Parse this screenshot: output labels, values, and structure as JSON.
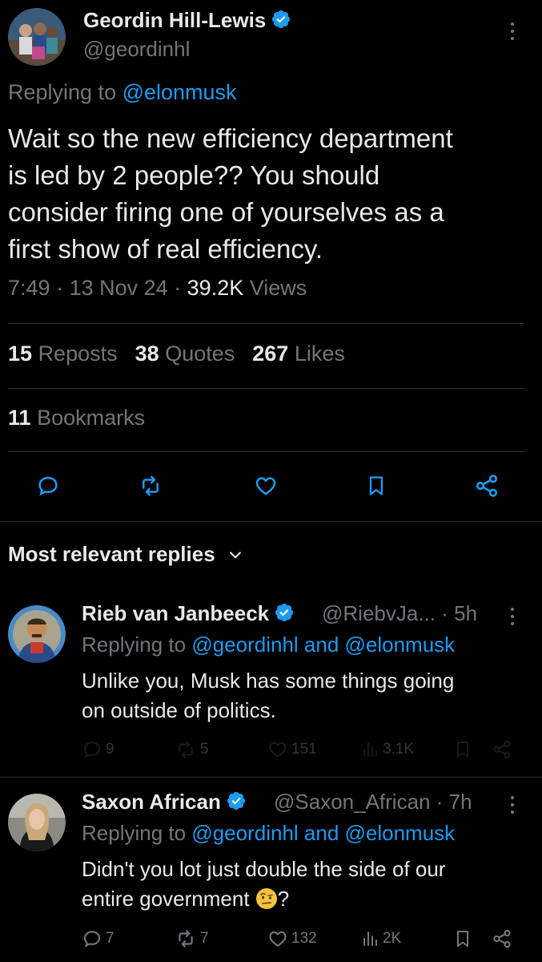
{
  "tweet": {
    "author_name": "Geordin Hill-Lewis",
    "author_handle": "@geordinhl",
    "replying_prefix": "Replying to ",
    "replying_to": "@elonmusk",
    "text_lines": [
      "Wait so the new efficiency department",
      "is led by 2 people?? You should",
      "consider firing one of yourselves as a",
      "first show of real efficiency."
    ],
    "time": "7:49",
    "date": "13 Nov 24",
    "views_count": "39.2K",
    "views_label": "Views",
    "separator": " · ",
    "reposts_count": "15",
    "reposts_label": "Reposts",
    "quotes_count": "38",
    "quotes_label": "Quotes",
    "likes_count": "267",
    "likes_label": "Likes",
    "bookmarks_count": "11",
    "bookmarks_label": "Bookmarks",
    "actions": [
      "reply-icon",
      "repost-icon",
      "like-icon",
      "bookmark-icon",
      "share-icon"
    ]
  },
  "replies_section": {
    "title": "Most relevant replies",
    "chevron": "chevron-down-icon"
  },
  "replies": [
    {
      "name": "Rieb van Janbeeck",
      "handle": "@RiebvJa...",
      "time": "5h",
      "replying_prefix": "Replying to ",
      "replying_to": "@geordinhl and @elonmusk",
      "text_lines": [
        "Unlike you, Musk has some things going",
        "on outside of politics."
      ],
      "reply_count": "9",
      "repost_count": "5",
      "like_count": "151",
      "views_count": "3.1K"
    },
    {
      "name": "Saxon African",
      "handle": "@Saxon_African",
      "time": "7h",
      "replying_prefix": "Replying to ",
      "replying_to": "@geordinhl and @elonmusk",
      "text_lines": [
        "Didn't you lot just double the side of our",
        "entire government"
      ],
      "text_suffix": "?",
      "emoji": "face-with-raised-eyebrow-emoji",
      "reply_count": "7",
      "repost_count": "7",
      "like_count": "132",
      "views_count": "2K"
    }
  ],
  "colors": {
    "background": "#000000",
    "text": "#e7e9ea",
    "muted": "#71767b",
    "link": "#1d9bf0",
    "verified": "#1d9bf0",
    "divider": "#2f3336"
  }
}
